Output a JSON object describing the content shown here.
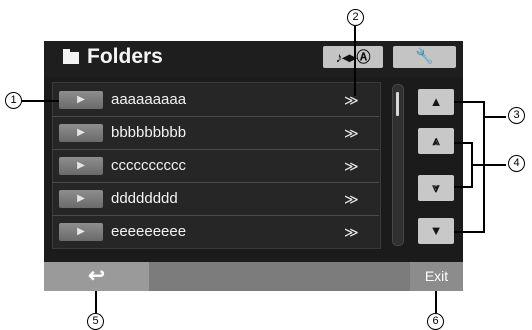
{
  "header": {
    "title": "Folders",
    "mode_button_label": "♪◂▸Ⓐ",
    "settings_button_label": "🔧"
  },
  "list": {
    "rows": [
      {
        "play_label": "▶",
        "label": "aaaaaaaaa",
        "expand_label": "≫"
      },
      {
        "play_label": "▶",
        "label": "bbbbbbbbb",
        "expand_label": "≫"
      },
      {
        "play_label": "▶",
        "label": "cccccccccc",
        "expand_label": "≫"
      },
      {
        "play_label": "▶",
        "label": "dddddddd",
        "expand_label": "≫"
      },
      {
        "play_label": "▶",
        "label": "eeeeeeeee",
        "expand_label": "≫"
      }
    ]
  },
  "nav": {
    "up_label": "▲",
    "page_up_label": "⩓",
    "page_down_label": "⩔",
    "down_label": "▼"
  },
  "footer": {
    "back_label": "↩",
    "exit_label": "Exit"
  },
  "callouts": {
    "c1": "1",
    "c2": "2",
    "c3": "3",
    "c4": "4",
    "c5": "5",
    "c6": "6"
  }
}
